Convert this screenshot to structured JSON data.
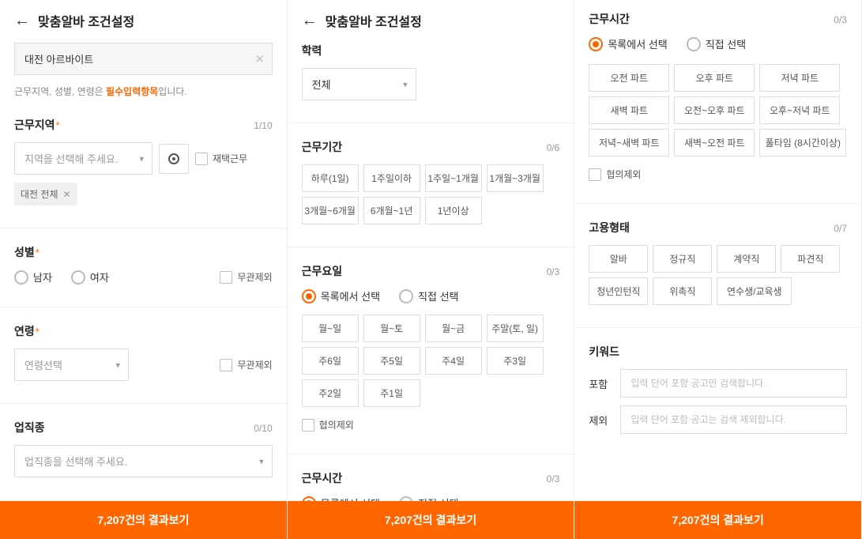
{
  "header": {
    "title": "맞춤알바 조건설정"
  },
  "search": {
    "value": "대전 아르바이트"
  },
  "note": {
    "prefix": "근무지역, 성별, 연령은 ",
    "required": "필수입력항목",
    "suffix": "입니다."
  },
  "region": {
    "title": "근무지역",
    "count": "1/10",
    "placeholder": "지역을 선택해 주세요.",
    "remote": "재택근무",
    "tag": "대전 전체"
  },
  "gender": {
    "title": "성별",
    "male": "남자",
    "female": "여자",
    "any": "무관제외"
  },
  "age": {
    "title": "연령",
    "placeholder": "연령선택",
    "any": "무관제외"
  },
  "jobtype": {
    "title": "업직종",
    "count": "0/10",
    "placeholder": "업직종을 선택해 주세요."
  },
  "education": {
    "title": "학력",
    "value": "전체"
  },
  "period": {
    "title": "근무기간",
    "count": "0/6",
    "chips": [
      "하루(1일)",
      "1주일이하",
      "1주일~1개월",
      "1개월~3개월",
      "3개월~6개월",
      "6개월~1년",
      "1년이상"
    ]
  },
  "days": {
    "title": "근무요일",
    "count": "0/3",
    "modeList": "목록에서 선택",
    "modeDirect": "직접 선택",
    "chips": [
      "월~일",
      "월~토",
      "월~금",
      "주말(토, 일)",
      "주6일",
      "주5일",
      "주4일",
      "주3일",
      "주2일",
      "주1일"
    ],
    "exclude": "협의제외"
  },
  "hours": {
    "title": "근무시간",
    "count": "0/3",
    "modeList": "목록에서 선택",
    "modeDirect": "직접 선택",
    "chips": [
      "오전 파트",
      "오후 파트",
      "저녁 파트",
      "새벽 파트",
      "오전~오후 파트",
      "오후~저녁 파트",
      "저녁~새벽 파트",
      "새벽~오전 파트",
      "풀타임 (8시간이상)"
    ],
    "exclude": "협의제외"
  },
  "employment": {
    "title": "고용형태",
    "count": "0/7",
    "chips": [
      "알바",
      "정규직",
      "계약직",
      "파견직",
      "청년인턴직",
      "위촉직",
      "연수생/교육생"
    ]
  },
  "keyword": {
    "title": "키워드",
    "includeLabel": "포함",
    "excludeLabel": "제외",
    "includePlaceholder": "입력 단어 포함 공고만 검색합니다.",
    "excludePlaceholder": "입력 단어 포함 공고는 검색 제외합니다."
  },
  "submit": "7,207건의 결과보기"
}
